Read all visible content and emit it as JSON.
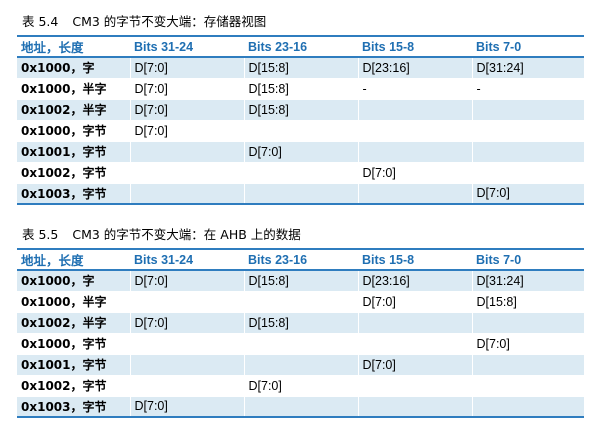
{
  "table1": {
    "caption_number": "表 5.4",
    "caption_title": "CM3 的字节不变大端：存储器视图",
    "headers": [
      "地址，长度",
      "Bits 31-24",
      "Bits 23-16",
      "Bits 15-8",
      "Bits 7-0"
    ],
    "rows": [
      [
        "0x1000，字",
        "D[7:0]",
        "D[15:8]",
        "D[23:16]",
        "D[31:24]"
      ],
      [
        "0x1000，半字",
        "D[7:0]",
        "D[15:8]",
        "-",
        "-"
      ],
      [
        "0x1002，半字",
        "D[7:0]",
        "D[15:8]",
        "",
        ""
      ],
      [
        "0x1000，字节",
        "D[7:0]",
        "",
        "",
        ""
      ],
      [
        "0x1001，字节",
        "",
        "D[7:0]",
        "",
        ""
      ],
      [
        "0x1002，字节",
        "",
        "",
        "D[7:0]",
        ""
      ],
      [
        "0x1003，字节",
        "",
        "",
        "",
        "D[7:0]"
      ]
    ]
  },
  "table2": {
    "caption_number": "表 5.5",
    "caption_title": "CM3 的字节不变大端：在 AHB 上的数据",
    "headers": [
      "地址，长度",
      "Bits 31-24",
      "Bits 23-16",
      "Bits 15-8",
      "Bits 7-0"
    ],
    "rows": [
      [
        "0x1000，字",
        "D[7:0]",
        "D[15:8]",
        "D[23:16]",
        "D[31:24]"
      ],
      [
        "0x1000，半字",
        "",
        "",
        "D[7:0]",
        "D[15:8]"
      ],
      [
        "0x1002，半字",
        "D[7:0]",
        "D[15:8]",
        "",
        ""
      ],
      [
        "0x1000，字节",
        "",
        "",
        "",
        "D[7:0]"
      ],
      [
        "0x1001，字节",
        "",
        "",
        "D[7:0]",
        ""
      ],
      [
        "0x1002，字节",
        "",
        "D[7:0]",
        "",
        ""
      ],
      [
        "0x1003，字节",
        "D[7:0]",
        "",
        "",
        ""
      ]
    ]
  },
  "colors": {
    "header_text": "#1f6fb2",
    "rule": "#2f7dbf",
    "row_shade": "#dbeaf3"
  }
}
